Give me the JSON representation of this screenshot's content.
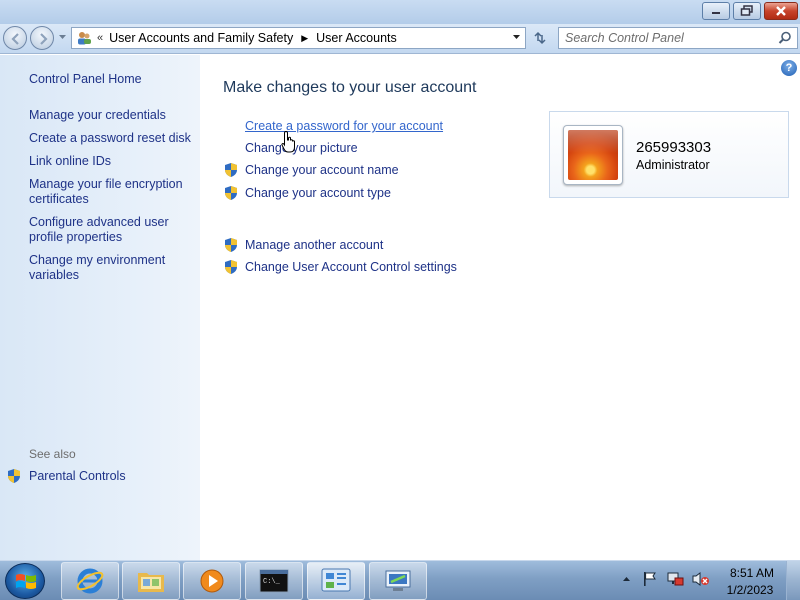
{
  "window": {
    "breadcrumb": [
      "User Accounts and Family Safety",
      "User Accounts"
    ],
    "breadcrumb_prefix": "«",
    "search_placeholder": "Search Control Panel"
  },
  "sidebar": {
    "home": "Control Panel Home",
    "items": [
      "Manage your credentials",
      "Create a password reset disk",
      "Link online IDs",
      "Manage your file encryption certificates",
      "Configure advanced user profile properties",
      "Change my environment variables"
    ],
    "see_also_label": "See also",
    "see_also_items": [
      "Parental Controls"
    ]
  },
  "main": {
    "title": "Make changes to your user account",
    "tasks": [
      {
        "label": "Create a password for your account",
        "shield": false
      },
      {
        "label": "Change your picture",
        "shield": false
      },
      {
        "label": "Change your account name",
        "shield": true
      },
      {
        "label": "Change your account type",
        "shield": true
      }
    ],
    "other_tasks": [
      {
        "label": "Manage another account",
        "shield": true
      },
      {
        "label": "Change User Account Control settings",
        "shield": true
      }
    ],
    "help_icon": "?"
  },
  "account": {
    "name": "265993303",
    "role": "Administrator"
  },
  "taskbar": {
    "pinned": [
      "start-orb",
      "internet-explorer-icon",
      "windows-explorer-icon",
      "media-player-icon",
      "command-prompt-icon",
      "control-panel-icon",
      "remote-desktop-icon"
    ],
    "time": "8:51 AM",
    "date": "1/2/2023"
  },
  "colors": {
    "link": "#1e3287",
    "title": "#1e395b",
    "sidebar_bg": "#dde9f7"
  }
}
